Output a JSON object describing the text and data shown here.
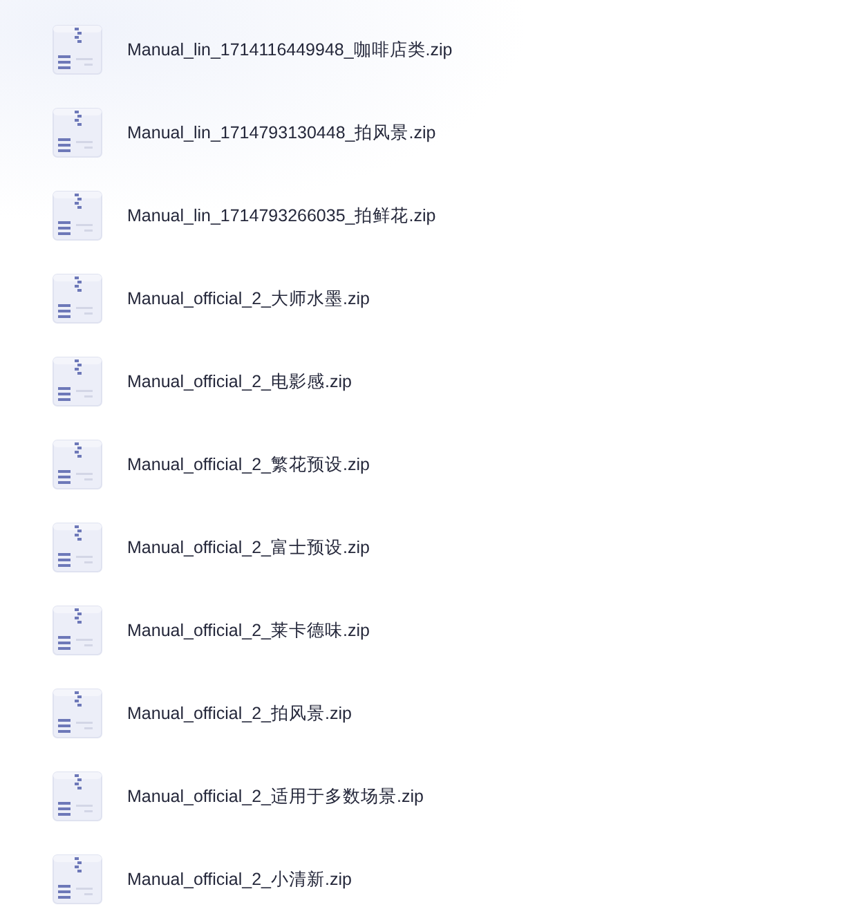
{
  "files": [
    {
      "name": "Manual_lin_1714116449948_咖啡店类.zip"
    },
    {
      "name": "Manual_lin_1714793130448_拍风景.zip"
    },
    {
      "name": "Manual_lin_1714793266035_拍鲜花.zip"
    },
    {
      "name": "Manual_official_2_大师水墨.zip"
    },
    {
      "name": "Manual_official_2_电影感.zip"
    },
    {
      "name": "Manual_official_2_繁花预设.zip"
    },
    {
      "name": "Manual_official_2_富士预设.zip"
    },
    {
      "name": "Manual_official_2_莱卡德味.zip"
    },
    {
      "name": "Manual_official_2_拍风景.zip"
    },
    {
      "name": "Manual_official_2_适用于多数场景.zip"
    },
    {
      "name": "Manual_official_2_小清新.zip"
    }
  ]
}
